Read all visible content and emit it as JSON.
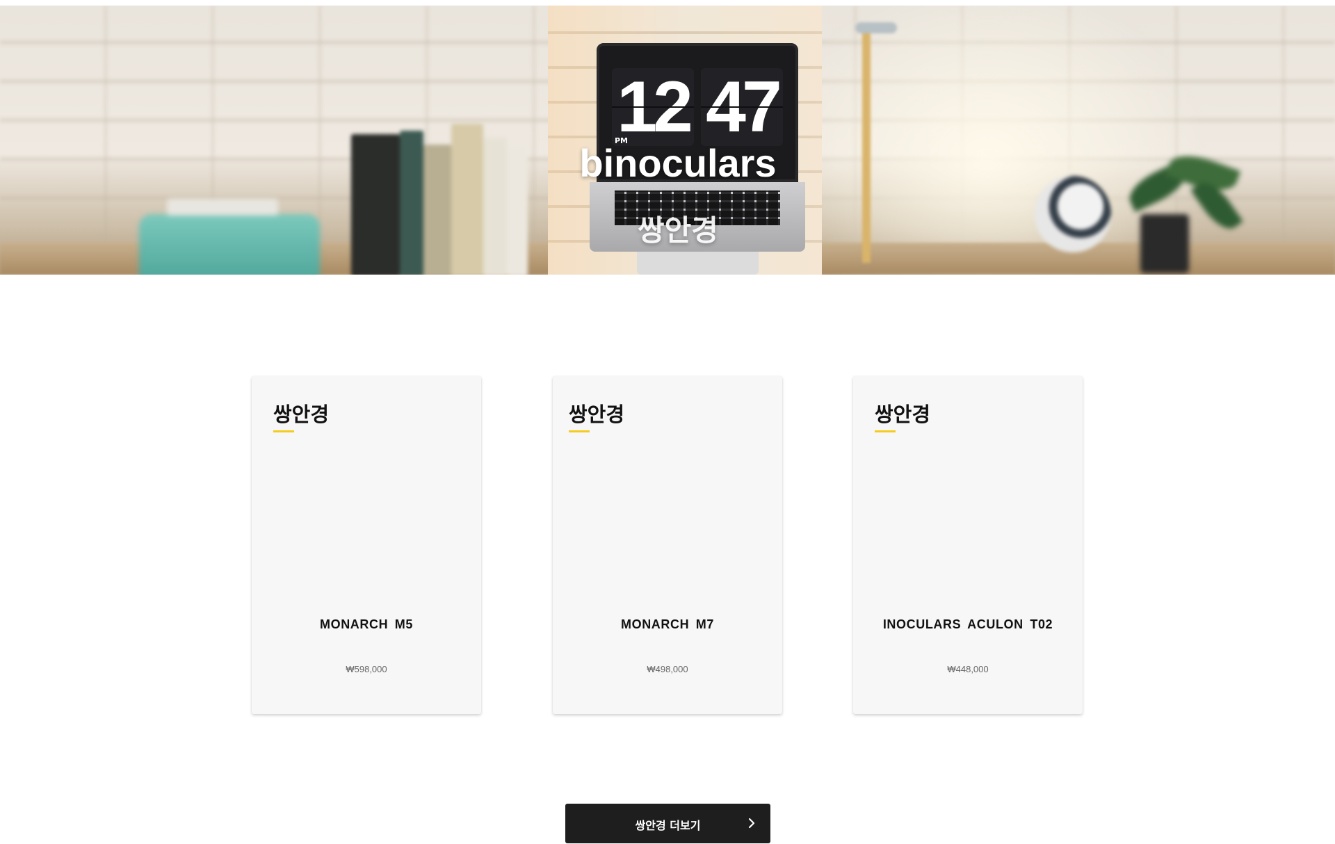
{
  "hero": {
    "clock_hour": "12",
    "clock_minute": "47",
    "clock_ampm": "PM",
    "title": "binoculars",
    "subtitle": "쌍안경"
  },
  "products": [
    {
      "category": "쌍안경",
      "name": "MONARCH  M5",
      "price": "₩598,000"
    },
    {
      "category": "쌍안경",
      "name": "MONARCH  M7",
      "price": "₩498,000"
    },
    {
      "category": "쌍안경",
      "name": "INOCULARS  ACULON  T02",
      "price": "₩448,000"
    }
  ],
  "more_button": {
    "label": "쌍안경 더보기",
    "icon": "chevron-right-icon"
  },
  "colors": {
    "accent": "#f4cc1e",
    "button_bg": "#1e1e1e",
    "card_bg": "#f7f7f7"
  }
}
